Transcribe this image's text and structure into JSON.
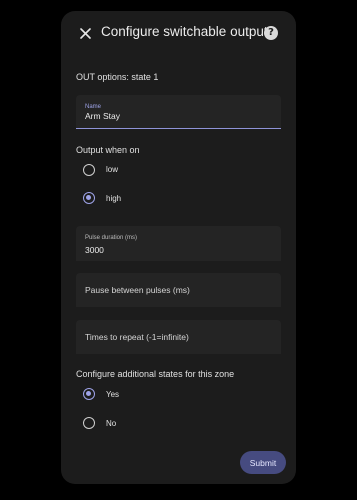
{
  "dialog": {
    "title": "Configure switchable output",
    "close_icon": "close-icon",
    "help_icon": "help-icon",
    "help_glyph": "?"
  },
  "out_options": "OUT options: state 1",
  "name_field": {
    "label": "Name",
    "value": "Arm Stay"
  },
  "output_when_on": {
    "label": "Output when on",
    "options": [
      {
        "label": "low",
        "checked": false
      },
      {
        "label": "high",
        "checked": true
      }
    ]
  },
  "pulse_duration": {
    "label": "Pulse duration (ms)",
    "value": "3000"
  },
  "pause_between_pulses": {
    "placeholder": "Pause between pulses (ms)"
  },
  "times_to_repeat": {
    "placeholder": "Times to repeat (-1=infinite)"
  },
  "additional_states": {
    "label": "Configure additional states for this zone",
    "options": [
      {
        "label": "Yes",
        "checked": true
      },
      {
        "label": "No",
        "checked": false
      }
    ]
  },
  "submit_label": "Submit",
  "colors": {
    "background": "#000000",
    "dialog": "#1c1c1c",
    "field": "#242424",
    "accent": "#9ea3e8",
    "submit": "#464b80"
  }
}
